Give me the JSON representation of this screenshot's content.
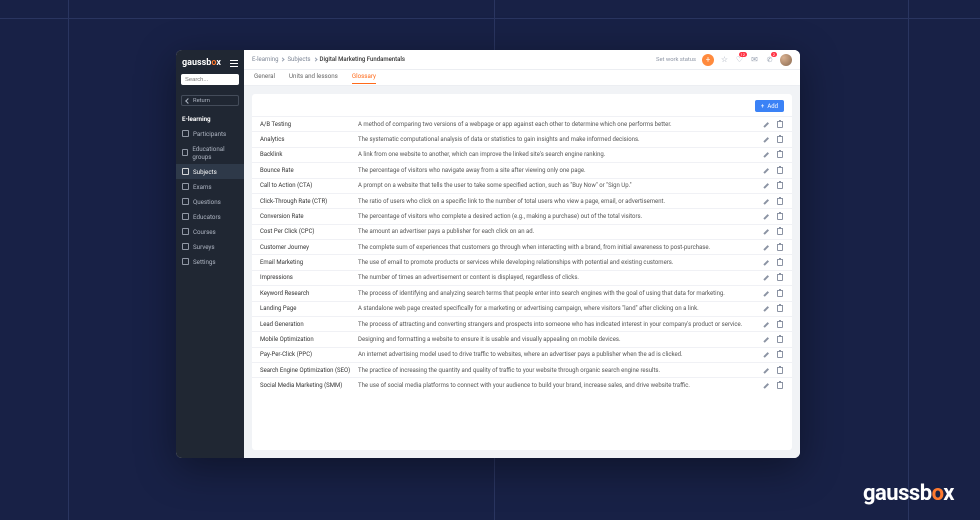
{
  "brand": "gaussbox",
  "search": {
    "placeholder": "Search..."
  },
  "sidebar": {
    "return_label": "Return",
    "section": "E-learning",
    "items": [
      {
        "label": "Participants"
      },
      {
        "label": "Educational groups"
      },
      {
        "label": "Subjects"
      },
      {
        "label": "Exams"
      },
      {
        "label": "Questions"
      },
      {
        "label": "Educators"
      },
      {
        "label": "Courses"
      },
      {
        "label": "Surveys"
      },
      {
        "label": "Settings"
      }
    ],
    "active_index": 2
  },
  "breadcrumb": {
    "items": [
      "E-learning",
      "Subjects",
      "Digital Marketing Fundamentals"
    ]
  },
  "topbar": {
    "status": "Set work status",
    "badges": {
      "bell": "12",
      "phone": "2"
    }
  },
  "tabs": {
    "items": [
      "General",
      "Units and lessons",
      "Glossary"
    ],
    "active_index": 2
  },
  "add_label": "Add",
  "glossary": [
    {
      "term": "A/B Testing",
      "def": "A method of comparing two versions of a webpage or app against each other to determine which one performs better."
    },
    {
      "term": "Analytics",
      "def": "The systematic computational analysis of data or statistics to gain insights and make informed decisions."
    },
    {
      "term": "Backlink",
      "def": "A link from one website to another, which can improve the linked site's search engine ranking."
    },
    {
      "term": "Bounce Rate",
      "def": "The percentage of visitors who navigate away from a site after viewing only one page."
    },
    {
      "term": "Call to Action (CTA)",
      "def": "A prompt on a website that tells the user to take some specified action, such as \"Buy Now\" or \"Sign Up.\""
    },
    {
      "term": "Click-Through Rate (CTR)",
      "def": "The ratio of users who click on a specific link to the number of total users who view a page, email, or advertisement."
    },
    {
      "term": "Conversion Rate",
      "def": "The percentage of visitors who complete a desired action (e.g., making a purchase) out of the total visitors."
    },
    {
      "term": "Cost Per Click (CPC)",
      "def": "The amount an advertiser pays a publisher for each click on an ad."
    },
    {
      "term": "Customer Journey",
      "def": "The complete sum of experiences that customers go through when interacting with a brand, from initial awareness to post-purchase."
    },
    {
      "term": "Email Marketing",
      "def": "The use of email to promote products or services while developing relationships with potential and existing customers."
    },
    {
      "term": "Impressions",
      "def": "The number of times an advertisement or content is displayed, regardless of clicks."
    },
    {
      "term": "Keyword Research",
      "def": "The process of identifying and analyzing search terms that people enter into search engines with the goal of using that data for marketing."
    },
    {
      "term": "Landing Page",
      "def": "A standalone web page created specifically for a marketing or advertising campaign, where visitors \"land\" after clicking on a link."
    },
    {
      "term": "Lead Generation",
      "def": "The process of attracting and converting strangers and prospects into someone who has indicated interest in your company's product or service."
    },
    {
      "term": "Mobile Optimization",
      "def": "Designing and formatting a website to ensure it is usable and visually appealing on mobile devices."
    },
    {
      "term": "Pay-Per-Click (PPC)",
      "def": "An internet advertising model used to drive traffic to websites, where an advertiser pays a publisher when the ad is clicked."
    },
    {
      "term": "Search Engine Optimization (SEO)",
      "def": "The practice of increasing the quantity and quality of traffic to your website through organic search engine results."
    },
    {
      "term": "Social Media Marketing (SMM)",
      "def": "The use of social media platforms to connect with your audience to build your brand, increase sales, and drive website traffic."
    }
  ]
}
